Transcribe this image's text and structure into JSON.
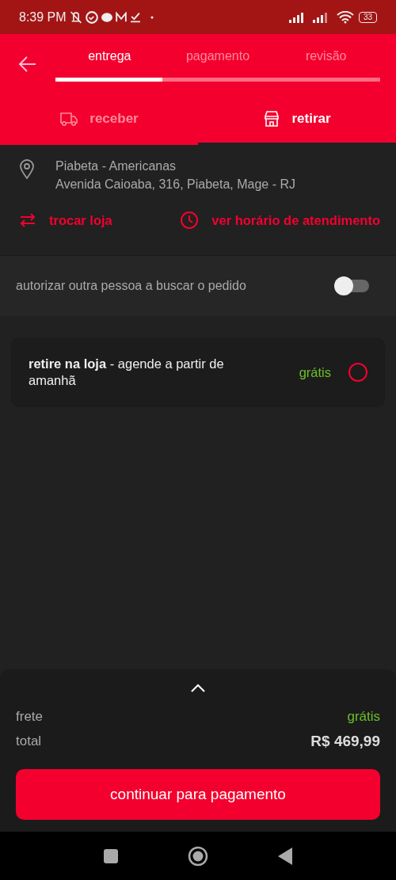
{
  "status_bar": {
    "time": "8:39 PM",
    "battery": "33"
  },
  "steps": {
    "items": [
      {
        "label": "entrega",
        "selected": true
      },
      {
        "label": "pagamento",
        "selected": false
      },
      {
        "label": "revisão",
        "selected": false
      }
    ],
    "level": 0.33
  },
  "modes": [
    {
      "label": "receber",
      "kind": "truck",
      "selected": false
    },
    {
      "label": "retirar",
      "kind": "store",
      "selected": true
    }
  ],
  "store": {
    "name": "Piabeta - Americanas",
    "address": "Avenida Caioaba, 316, Piabeta, Mage - RJ"
  },
  "store_actions": [
    {
      "label": "trocar loja",
      "kind": "swap"
    },
    {
      "label": "ver horário de atendimento",
      "kind": "clock"
    }
  ],
  "authorize": {
    "label": "autorizar outra pessoa a buscar o pedido",
    "on": false
  },
  "options": [
    {
      "text": "**retire na loja** - agende a partir de amanhã",
      "price": "grátis",
      "selected": false
    }
  ],
  "summary": {
    "rows": [
      {
        "label": "frete",
        "value": "grátis",
        "kind": "free"
      },
      {
        "label": "total",
        "value": "R$ 469,99",
        "kind": "total"
      }
    ],
    "button": "continuar para pagamento"
  }
}
